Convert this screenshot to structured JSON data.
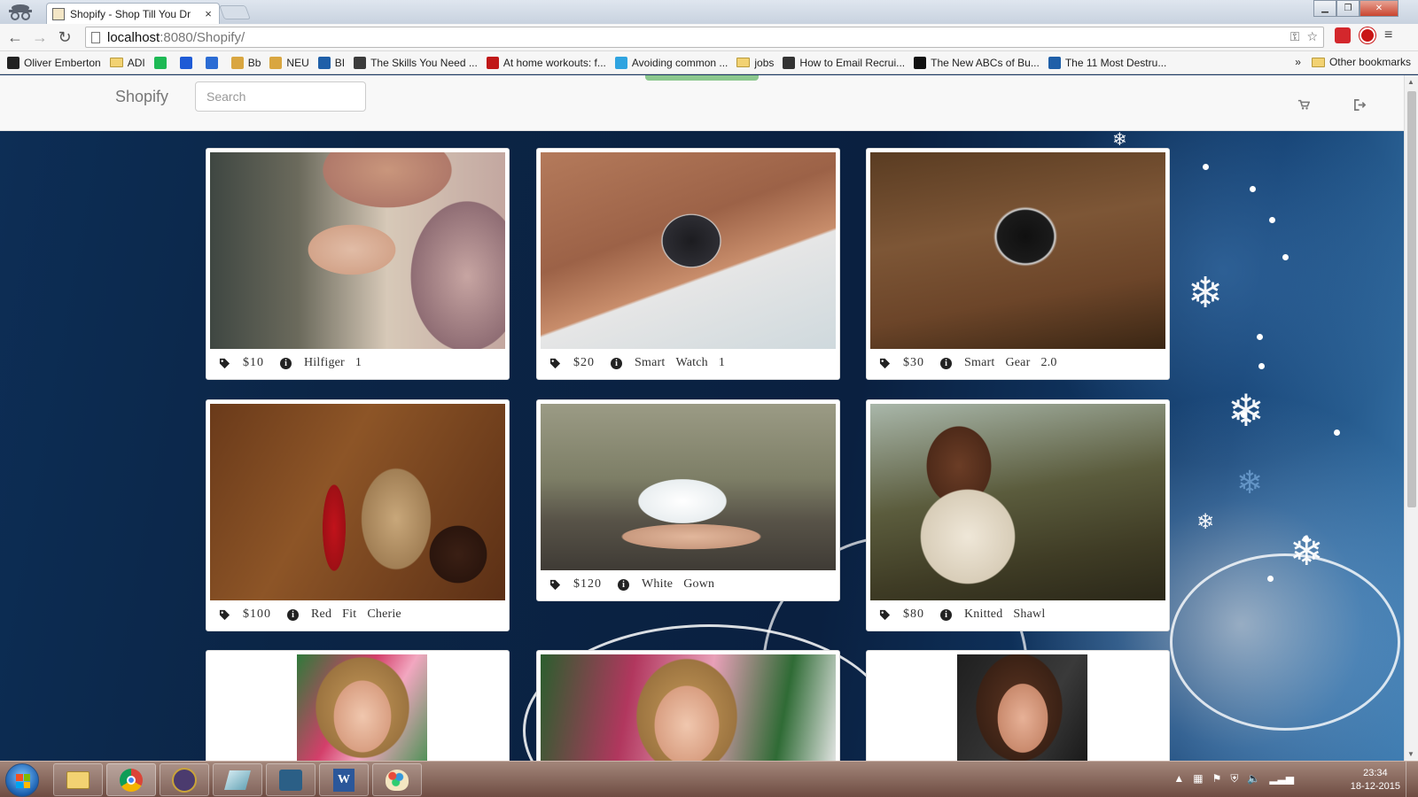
{
  "browser": {
    "tab_title": "Shopify - Shop Till You Dr",
    "tab_close": "×",
    "url_host": "localhost",
    "url_path": ":8080/Shopify/",
    "bookmarks": [
      {
        "label": "Oliver Emberton",
        "icon_color": "#222222",
        "type": "site"
      },
      {
        "label": "ADI",
        "icon_color": "#f2d272",
        "type": "folder"
      },
      {
        "label": "",
        "icon_color": "#1db954",
        "type": "site"
      },
      {
        "label": "",
        "icon_color": "#1e5bd6",
        "type": "site"
      },
      {
        "label": "",
        "icon_color": "#2b6cd4",
        "type": "site"
      },
      {
        "label": "Bb",
        "icon_color": "#d9a640",
        "type": "site"
      },
      {
        "label": "NEU",
        "icon_color": "#d9a640",
        "type": "site"
      },
      {
        "label": "BI",
        "icon_color": "#1f5fa8",
        "type": "site"
      },
      {
        "label": "The Skills You Need ...",
        "icon_color": "#3b3b3b",
        "type": "site"
      },
      {
        "label": "At home workouts: f...",
        "icon_color": "#c01818",
        "type": "site"
      },
      {
        "label": "Avoiding common ...",
        "icon_color": "#2fa4e0",
        "type": "site"
      },
      {
        "label": "jobs",
        "icon_color": "#f2d272",
        "type": "folder"
      },
      {
        "label": "How to Email Recrui...",
        "icon_color": "#333333",
        "type": "site"
      },
      {
        "label": "The New ABCs of Bu...",
        "icon_color": "#111111",
        "type": "site"
      },
      {
        "label": "The 11 Most Destru...",
        "icon_color": "#1f5fa8",
        "type": "site"
      }
    ],
    "bookmarks_overflow": "»",
    "other_bookmarks": "Other bookmarks"
  },
  "navbar": {
    "brand": "Shopify",
    "search_placeholder": "Search"
  },
  "products": [
    {
      "price": "$10",
      "name": [
        "Hilfiger",
        "1"
      ],
      "image": "woman-wrist-watch"
    },
    {
      "price": "$20",
      "name": [
        "Smart",
        "Watch",
        "1"
      ],
      "image": "smart-watch-hand"
    },
    {
      "price": "$30",
      "name": [
        "Smart",
        "Gear",
        "2.0"
      ],
      "image": "smart-gear-wrist"
    },
    {
      "price": "$100",
      "name": [
        "Red",
        "Fit",
        "Cherie"
      ],
      "image": "red-dress-armchair"
    },
    {
      "price": "$120",
      "name": [
        "White",
        "Gown"
      ],
      "image": "white-gown-rock"
    },
    {
      "price": "$80",
      "name": [
        "Knitted",
        "Shawl"
      ],
      "image": "knitted-shawl-field"
    },
    {
      "price": "",
      "name": [],
      "image": "portrait-flowers-1"
    },
    {
      "price": "",
      "name": [],
      "image": "portrait-flowers-2"
    },
    {
      "price": "",
      "name": [],
      "image": "portrait-dark"
    }
  ],
  "taskbar": {
    "time": "23:34",
    "date": "18-12-2015"
  }
}
